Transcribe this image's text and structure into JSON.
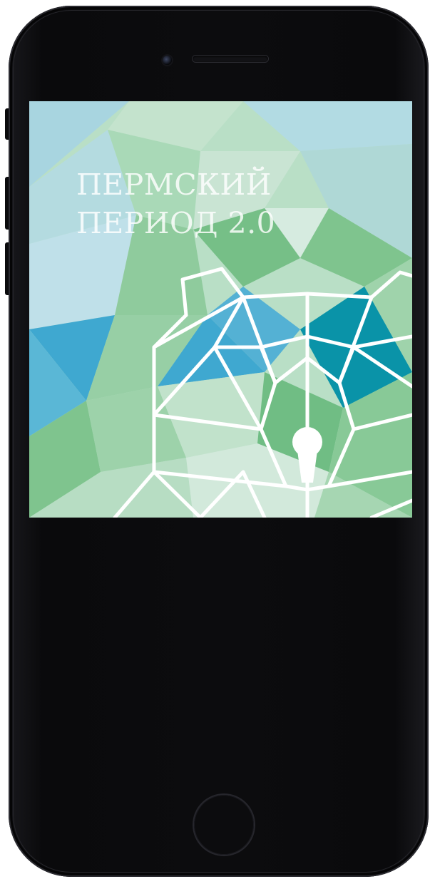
{
  "app": {
    "title_line1": "ПЕРМСКИЙ",
    "title_line2": "ПЕРИОД 2.0"
  },
  "colors": {
    "bezel": "#0b0b0d",
    "light_blue": "#a8d5e0",
    "light_green": "#b9dfc6",
    "green": "#7fc48e",
    "deep_blue": "#3fa8d0",
    "teal": "#0a93a8",
    "line_art": "#ffffff"
  },
  "icons": {
    "bear": "bear-logo-icon",
    "keyhole": "keyhole-icon"
  }
}
